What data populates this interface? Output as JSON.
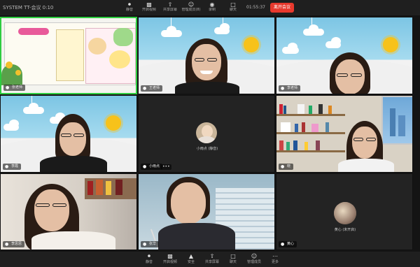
{
  "window": {
    "title": "SYSTEM   TT-会议 0:10"
  },
  "toolbar": {
    "items": [
      {
        "label": "静音",
        "icon": "mic-icon"
      },
      {
        "label": "开启视频",
        "icon": "video-icon"
      },
      {
        "label": "共享屏幕",
        "icon": "share-icon"
      },
      {
        "label": "管理成员(8)",
        "icon": "members-icon"
      },
      {
        "label": "录制",
        "icon": "record-icon"
      },
      {
        "label": "聊天",
        "icon": "chat-icon"
      }
    ],
    "timer": "01:55:37",
    "end_label": "离开会议"
  },
  "tiles": [
    {
      "name": "张老师",
      "type": "screen"
    },
    {
      "name": "王老师",
      "type": "camera"
    },
    {
      "name": "李老师",
      "type": "camera"
    },
    {
      "name": "李霞",
      "type": "camera"
    },
    {
      "name": "小雨点",
      "type": "avatar",
      "avatar_label": "小雨点 (静音)"
    },
    {
      "name": "晓",
      "type": "camera"
    },
    {
      "name": "李思思",
      "type": "camera"
    },
    {
      "name": "张华",
      "type": "camera"
    },
    {
      "name": "黄心",
      "type": "avatar",
      "avatar_label": "黄心 (未开启)"
    }
  ],
  "bottombar": {
    "items": [
      {
        "label": "静音",
        "icon": "mic-icon"
      },
      {
        "label": "开启视频",
        "icon": "video-icon"
      },
      {
        "label": "安全",
        "icon": "shield-icon"
      },
      {
        "label": "共享屏幕",
        "icon": "share-icon"
      },
      {
        "label": "聊天",
        "icon": "chat-icon"
      },
      {
        "label": "管理成员",
        "icon": "members-icon"
      },
      {
        "label": "更多",
        "icon": "more-icon"
      }
    ]
  },
  "colors": {
    "active_border": "#2ecc40",
    "end_button": "#e8392d",
    "sky": "#7cc5e4",
    "sun": "#f7c21a"
  }
}
